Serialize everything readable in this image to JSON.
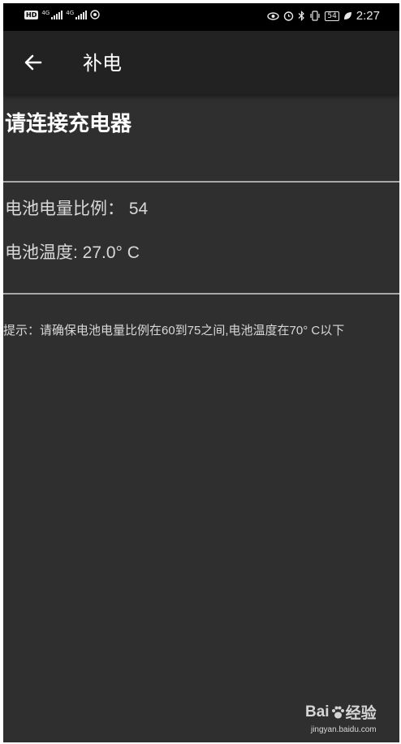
{
  "status_bar": {
    "hd_label": "HD",
    "signal_1_label": "4G",
    "signal_2_label": "4G",
    "battery_level": "54",
    "time": "2:27"
  },
  "app_bar": {
    "title": "补电"
  },
  "main": {
    "prompt": "请连接充电器",
    "battery_level_line": "电池电量比例： 54",
    "battery_temp_line": "电池温度: 27.0° C",
    "hint": "提示：请确保电池电量比例在60到75之间,电池温度在70° C以下"
  },
  "watermark": {
    "brand_left": "Bai",
    "brand_right": "经验",
    "url": "jingyan.baidu.com"
  },
  "colors": {
    "background": "#2f2f2f",
    "app_bar": "#222222",
    "status_bar": "#000000",
    "divider": "#a8a8a8",
    "text_primary": "#ffffff",
    "text_secondary": "#d8d8d8"
  }
}
